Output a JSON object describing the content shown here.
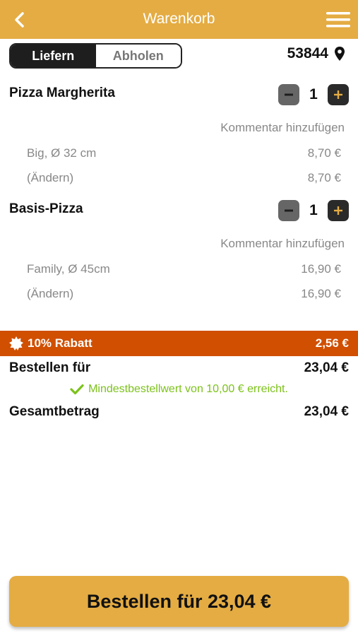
{
  "header": {
    "title": "Warenkorb"
  },
  "delivery_toggle": {
    "options": [
      "Liefern",
      "Abholen"
    ],
    "selected": "Liefern"
  },
  "zip_code": "53844",
  "items": [
    {
      "name": "Pizza Margherita",
      "quantity": "1",
      "comment_link": "Kommentar hinzufügen",
      "options": [
        {
          "label": "Big, Ø 32 cm",
          "price": "8,70 €"
        },
        {
          "label": "(Ändern)",
          "price": "8,70 €"
        }
      ]
    },
    {
      "name": "Basis-Pizza",
      "quantity": "1",
      "comment_link": "Kommentar hinzufügen",
      "options": [
        {
          "label": "Family, Ø 45cm",
          "price": "16,90 €"
        },
        {
          "label": "(Ändern)",
          "price": "16,90 €"
        }
      ]
    }
  ],
  "discount": {
    "label": "10% Rabatt",
    "value": "2,56 €"
  },
  "summary": {
    "order_for_label": "Bestellen für",
    "order_for_value": "23,04 €",
    "min_order_note": "Mindestbestellwert von 10,00 € erreicht.",
    "total_label": "Gesamtbetrag",
    "total_value": "23,04 €"
  },
  "order_button": {
    "label": "Bestellen für 23,04 €"
  },
  "colors": {
    "accent": "#e4ac43",
    "discount": "#d04f00",
    "success": "#7cc21a",
    "dark": "#1e1e1e"
  }
}
